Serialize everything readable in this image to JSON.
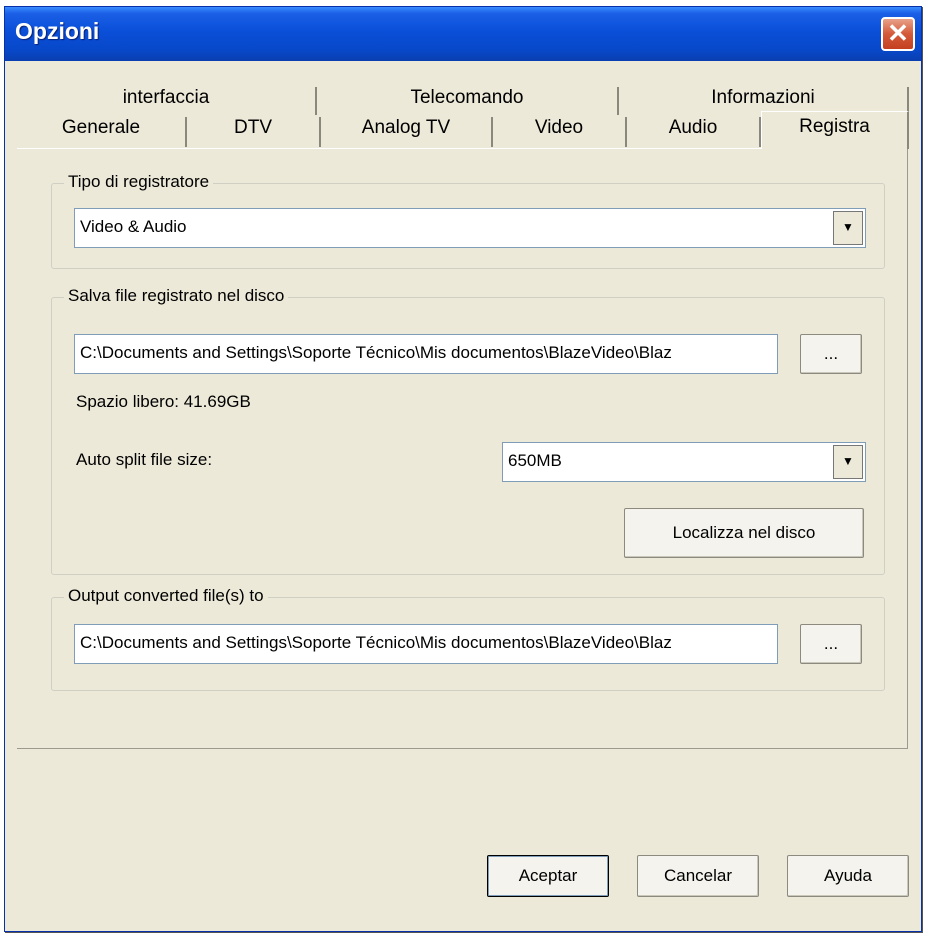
{
  "window": {
    "title": "Opzioni"
  },
  "tabs": {
    "back_row": [
      "interfaccia",
      "Telecomando",
      "Informazioni"
    ],
    "front_row": [
      "Generale",
      "DTV",
      "Analog TV",
      "Video",
      "Audio",
      "Registra"
    ]
  },
  "recorder_group": {
    "legend": "Tipo di registratore",
    "selected": "Video & Audio"
  },
  "save_group": {
    "legend": "Salva file registrato nel disco",
    "path": "C:\\Documents and Settings\\Soporte Técnico\\Mis documentos\\BlazeVideo\\Blaz",
    "browse_label": "...",
    "free_space": "Spazio libero: 41.69GB",
    "split_label": "Auto split file size:",
    "split_value": "650MB",
    "locate_label": "Localizza nel disco"
  },
  "output_group": {
    "legend": "Output converted file(s) to",
    "path": "C:\\Documents and Settings\\Soporte Técnico\\Mis documentos\\BlazeVideo\\Blaz",
    "browse_label": "..."
  },
  "footer": {
    "ok_label": "Aceptar",
    "cancel_label": "Cancelar",
    "help_label": "Ayuda"
  },
  "icons": {
    "close": "close-icon",
    "dropdown": "dropdown-arrow-icon"
  }
}
